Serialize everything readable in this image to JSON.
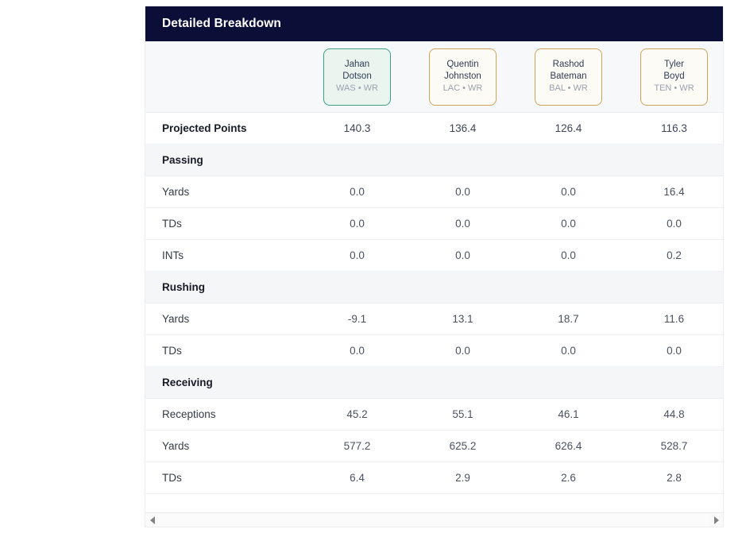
{
  "panel": {
    "title": "Detailed Breakdown"
  },
  "players": [
    {
      "first_name": "Jahan",
      "last_name": "Dotson",
      "team": "WAS",
      "position": "WR",
      "meta": "WAS • WR",
      "selected": true,
      "border_color": "#3f9e82",
      "background_color": "#eaf5f0"
    },
    {
      "first_name": "Quentin",
      "last_name": "Johnston",
      "team": "LAC",
      "position": "WR",
      "meta": "LAC • WR",
      "selected": false,
      "border_color": "#cfa45a",
      "background_color": "#fdfbf6"
    },
    {
      "first_name": "Rashod",
      "last_name": "Bateman",
      "team": "BAL",
      "position": "WR",
      "meta": "BAL • WR",
      "selected": false,
      "border_color": "#cfa45a",
      "background_color": "#fdfbf6"
    },
    {
      "first_name": "Tyler",
      "last_name": "Boyd",
      "team": "TEN",
      "position": "WR",
      "meta": "TEN • WR",
      "selected": false,
      "border_color": "#cfa45a",
      "background_color": "#fdfbf6"
    }
  ],
  "rows": [
    {
      "type": "stat",
      "label": "Projected Points",
      "emphasis": true,
      "values": [
        "140.3",
        "136.4",
        "126.4",
        "116.3"
      ]
    },
    {
      "type": "section",
      "label": "Passing"
    },
    {
      "type": "stat",
      "label": "Yards",
      "emphasis": false,
      "values": [
        "0.0",
        "0.0",
        "0.0",
        "16.4"
      ]
    },
    {
      "type": "stat",
      "label": "TDs",
      "emphasis": false,
      "values": [
        "0.0",
        "0.0",
        "0.0",
        "0.0"
      ]
    },
    {
      "type": "stat",
      "label": "INTs",
      "emphasis": false,
      "values": [
        "0.0",
        "0.0",
        "0.0",
        "0.2"
      ]
    },
    {
      "type": "section",
      "label": "Rushing"
    },
    {
      "type": "stat",
      "label": "Yards",
      "emphasis": false,
      "values": [
        "-9.1",
        "13.1",
        "18.7",
        "11.6"
      ]
    },
    {
      "type": "stat",
      "label": "TDs",
      "emphasis": false,
      "values": [
        "0.0",
        "0.0",
        "0.0",
        "0.0"
      ]
    },
    {
      "type": "section",
      "label": "Receiving"
    },
    {
      "type": "stat",
      "label": "Receptions",
      "emphasis": false,
      "values": [
        "45.2",
        "55.1",
        "46.1",
        "44.8"
      ]
    },
    {
      "type": "stat",
      "label": "Yards",
      "emphasis": false,
      "values": [
        "577.2",
        "625.2",
        "626.4",
        "528.7"
      ]
    },
    {
      "type": "stat",
      "label": "TDs",
      "emphasis": false,
      "values": [
        "6.4",
        "2.9",
        "2.6",
        "2.8"
      ]
    }
  ],
  "scrollbar": {
    "left_arrow_icon": "triangle-left-icon",
    "right_arrow_icon": "triangle-right-icon"
  },
  "colors": {
    "header_background": "#0b0f38",
    "header_text": "#ffffff",
    "selected_accent": "#3f9e82",
    "unselected_accent": "#cfa45a",
    "section_row_background": "#f5f6f8",
    "panel_background": "#ffffff"
  }
}
